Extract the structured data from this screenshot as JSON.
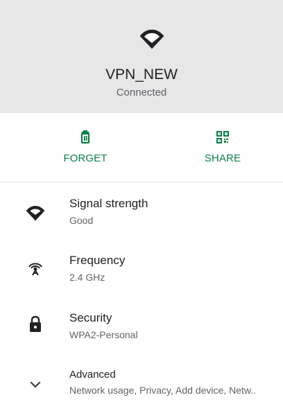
{
  "colors": {
    "header_background": "#e7e7e7",
    "accent": "#0a7f46",
    "primary_text": "#202124",
    "secondary_text": "#5f6368"
  },
  "header": {
    "network_name": "VPN_NEW",
    "status": "Connected",
    "icon": "wifi-icon"
  },
  "actions": {
    "forget": {
      "label": "FORGET",
      "icon": "trash-icon"
    },
    "share": {
      "label": "SHARE",
      "icon": "qr-code-icon"
    }
  },
  "details": [
    {
      "title": "Signal strength",
      "value": "Good",
      "icon": "wifi-signal-icon"
    },
    {
      "title": "Frequency",
      "value": "2.4 GHz",
      "icon": "antenna-icon"
    },
    {
      "title": "Security",
      "value": "WPA2-Personal",
      "icon": "lock-icon"
    },
    {
      "title": "Advanced",
      "value": "Network usage, Privacy, Add device, Netw..",
      "icon": "chevron-down-icon"
    }
  ]
}
